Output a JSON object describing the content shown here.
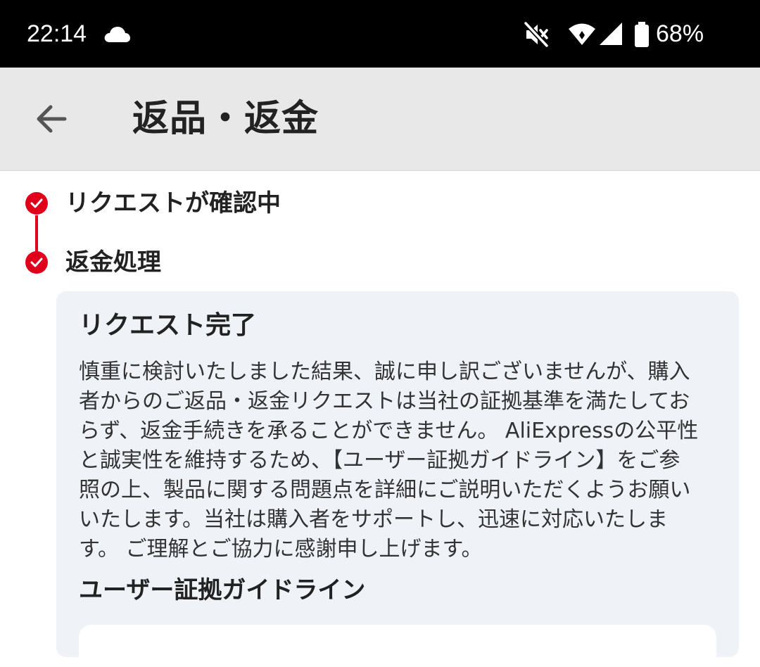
{
  "status_bar": {
    "time": "22:14",
    "battery": "68%",
    "icons": [
      "cloud-icon",
      "mute-icon",
      "wifi-icon",
      "signal-icon",
      "battery-icon"
    ]
  },
  "header": {
    "title": "返品・返金",
    "back_icon": "arrow-left-icon"
  },
  "steps": [
    {
      "label": "リクエストが確認中",
      "status": "completed"
    },
    {
      "label": "返金処理",
      "status": "completed"
    }
  ],
  "card": {
    "title": "リクエスト完了",
    "body": "慎重に検討いたしました結果、誠に申し訳ございませんが、購入者からのご返品・返金リクエストは当社の証拠基準を満たしておらず、返金手続きを承ることができません。 AliExpressの公平性と誠実性を維持するため、【ユーザー証拠ガイドライン】をご参照の上、製品に関する問題点を詳細にご説明いただくようお願いいたします。当社は購入者をサポートし、迅速に対応いたします。 ご理解とご協力に感謝申し上げます。",
    "subtitle": "ユーザー証拠ガイドライン"
  },
  "colors": {
    "accent": "#e0001c",
    "app_bar": "#e8e8e8",
    "card_bg": "#eff2f7",
    "status_bar": "#000000"
  }
}
